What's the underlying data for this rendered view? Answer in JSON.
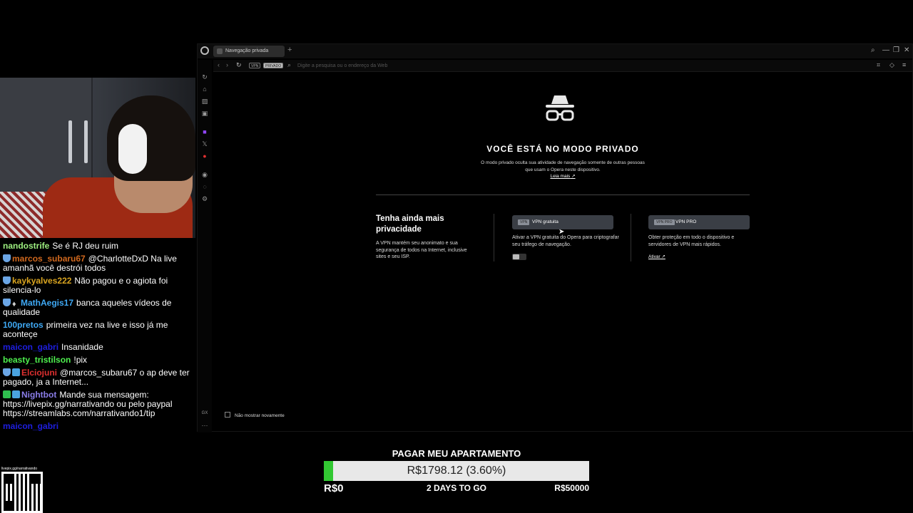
{
  "chat": {
    "messages": [
      {
        "user": "nandostrife",
        "color": "#9ef080",
        "badges": [],
        "text": "Se é RJ deu ruim"
      },
      {
        "user": "marcos_subaru67",
        "color": "#d2691e",
        "badges": [
          "shield"
        ],
        "text": "@CharlotteDxD Na live amanhã você destrói todos"
      },
      {
        "user": "kaykyalves222",
        "color": "#daa520",
        "badges": [
          "shield"
        ],
        "text": "Não pagou e o agiota foi silencia-lo"
      },
      {
        "user": "MathAegis17",
        "color": "#3fa9f5",
        "badges": [
          "shield",
          "gem"
        ],
        "text": "banca aqueles vídeos de qualidade"
      },
      {
        "user": "100pretos",
        "color": "#3fa9f5",
        "badges": [],
        "text": "primeira vez na live e isso já me aconteçe"
      },
      {
        "user": "maicon_gabri",
        "color": "#1e1ee0",
        "badges": [],
        "text": "Insanidade"
      },
      {
        "user": "beasty_tristilson",
        "color": "#4ef04e",
        "badges": [],
        "text": "!pix"
      },
      {
        "user": "Elciojuni",
        "color": "#e03030",
        "badges": [
          "shield",
          "screen"
        ],
        "text": "@marcos_subaru67 o ap deve ter pagado, ja a Internet..."
      },
      {
        "user": "Nightbot",
        "color": "#8a7de8",
        "badges": [
          "check",
          "screen"
        ],
        "text": "Mande sua mensagem: https://livepix.gg/narrativando ou pelo paypal https://streamlabs.com/narrativando1/tip"
      },
      {
        "user": "maicon_gabri",
        "color": "#1e1ee0",
        "badges": [],
        "text": ""
      }
    ]
  },
  "qr": {
    "caption": "livepix.gg/narrativando"
  },
  "browser": {
    "tab_title": "Navegação privada",
    "new_tab": "+",
    "vpn_pill": "VPN",
    "private_pill": "PRIVADO",
    "address_placeholder": "Digite a pesquisa ou o endereço da Web",
    "private": {
      "title": "VOCÊ ESTÁ NO MODO PRIVADO",
      "description": "O modo privado oculta sua atividade de navegação somente de outras pessoas que usam o Opera neste dispositivo.",
      "read_more": "Leia mais",
      "more_title": "Tenha ainda mais privacidade",
      "more_desc": "A VPN mantém seu anonimato e sua segurança de todos na Internet, inclusive sites e seu ISP.",
      "vpn_free": {
        "tag": "VPN",
        "label": "VPN gratuita",
        "desc": "Ativar a VPN gratuita do Opera para criptografar seu tráfego de navegação."
      },
      "vpn_pro": {
        "tag": "VPN PRO",
        "label": "VPN PRO",
        "desc": "Obter proteção em todo o dispositivo e servidores de VPN mais rápidos.",
        "activate": "Ativar"
      },
      "dont_show": "Não mostrar novamente"
    }
  },
  "goal": {
    "title": "PAGAR MEU APARTAMENTO",
    "progress_text": "R$1798.12 (3.60%)",
    "progress_fraction": 0.036,
    "min_label": "R$0",
    "days_label": "2 DAYS TO GO",
    "max_label": "R$50000",
    "fill_color": "#32c832"
  }
}
